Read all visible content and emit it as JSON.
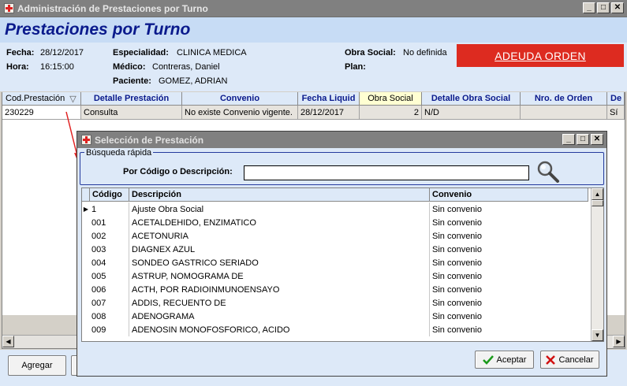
{
  "window": {
    "title": "Administración de Prestaciones por Turno",
    "controls": {
      "minimize": "_",
      "maximize": "□",
      "close": "✕"
    }
  },
  "page_title": "Prestaciones por Turno",
  "info": {
    "fecha_label": "Fecha:",
    "fecha_value": "28/12/2017",
    "hora_label": "Hora:",
    "hora_value": "16:15:00",
    "especialidad_label": "Especialidad:",
    "especialidad_value": "CLINICA MEDICA",
    "medico_label": "Médico:",
    "medico_value": "Contreras, Daniel",
    "paciente_label": "Paciente:",
    "paciente_value": "GOMEZ, ADRIAN",
    "obra_social_label": "Obra Social:",
    "obra_social_value": "No definida",
    "plan_label": "Plan:",
    "debt_label": "ADEUDA ORDEN"
  },
  "main_grid": {
    "headers": [
      "Cod.Prestación",
      "Detalle Prestación",
      "Convenio",
      "Fecha Liquid",
      "Obra Social",
      "Detalle Obra Social",
      "Nro. de Orden",
      "De"
    ],
    "filter_icon": "▽",
    "row": [
      "230229",
      "Consulta",
      "No existe Convenio vigente.",
      "28/12/2017",
      "2",
      "N/D",
      "",
      "Sí"
    ]
  },
  "bottom": {
    "add_label": "Agregar"
  },
  "dialog": {
    "title": "Selección de Prestación",
    "controls": {
      "minimize": "_",
      "maximize": "□",
      "close": "✕"
    },
    "group_label": "Búsqueda rápida",
    "search_label": "Por Código o Descripción:",
    "search_value": "",
    "headers": [
      "Código",
      "Descripción",
      "Convenio"
    ],
    "rows": [
      [
        "1",
        "Ajuste Obra Social",
        "Sin convenio"
      ],
      [
        "001",
        "ACETALDEHIDO, ENZIMATICO",
        "Sin convenio"
      ],
      [
        "002",
        "ACETONURIA",
        "Sin convenio"
      ],
      [
        "003",
        "DIAGNEX AZUL",
        "Sin convenio"
      ],
      [
        "004",
        "SONDEO GASTRICO SERIADO",
        "Sin convenio"
      ],
      [
        "005",
        "ASTRUP, NOMOGRAMA DE",
        "Sin convenio"
      ],
      [
        "006",
        "ACTH, POR RADIOINMUNOENSAYO",
        "Sin convenio"
      ],
      [
        "007",
        "ADDIS, RECUENTO DE",
        "Sin convenio"
      ],
      [
        "008",
        "ADENOGRAMA",
        "Sin convenio"
      ],
      [
        "009",
        "ADENOSIN MONOFOSFORICO, ACIDO",
        "Sin convenio"
      ]
    ],
    "accept_label": "Aceptar",
    "cancel_label": "Cancelar"
  }
}
